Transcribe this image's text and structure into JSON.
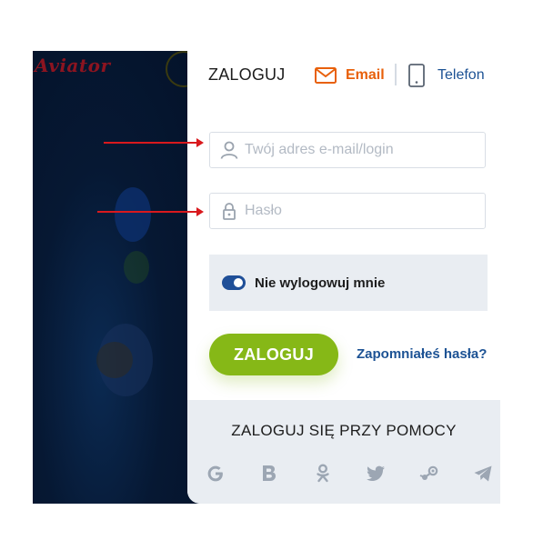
{
  "background": {
    "logo_text": "Aviator"
  },
  "login": {
    "title": "ZALOGUJ",
    "tabs": [
      {
        "label": "Email",
        "icon": "envelope-icon",
        "active": true
      },
      {
        "label": "Telefon",
        "icon": "phone-icon",
        "active": false
      }
    ],
    "email_placeholder": "Twój adres e-mail/login",
    "password_placeholder": "Hasło",
    "remember_label": "Nie wylogowuj mnie",
    "remember_checked": true,
    "submit_label": "ZALOGUJ",
    "forgot_label": "Zapomniałeś hasła?"
  },
  "social": {
    "title": "ZALOGUJ SIĘ PRZY POMOCY",
    "icons": [
      "google-icon",
      "vk-icon",
      "odnoklassniki-icon",
      "twitter-icon",
      "steam-icon",
      "telegram-icon"
    ]
  },
  "colors": {
    "accent_orange": "#e8600a",
    "link_blue": "#1c5294",
    "button_green": "#86b817",
    "toggle_blue": "#1f4f98",
    "annotation_red": "#d9191d"
  }
}
